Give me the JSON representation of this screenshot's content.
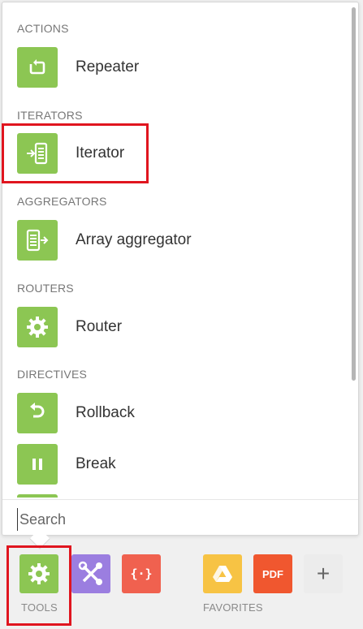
{
  "sections": [
    {
      "title": "ACTIONS",
      "items": [
        {
          "label": "Repeater",
          "icon": "repeat-icon"
        }
      ]
    },
    {
      "title": "ITERATORS",
      "items": [
        {
          "label": "Iterator",
          "icon": "iterator-icon"
        }
      ]
    },
    {
      "title": "AGGREGATORS",
      "items": [
        {
          "label": "Array aggregator",
          "icon": "aggregator-icon"
        }
      ]
    },
    {
      "title": "ROUTERS",
      "items": [
        {
          "label": "Router",
          "icon": "gear-icon"
        }
      ]
    },
    {
      "title": "DIRECTIVES",
      "items": [
        {
          "label": "Rollback",
          "icon": "rollback-icon"
        },
        {
          "label": "Break",
          "icon": "pause-icon"
        }
      ]
    }
  ],
  "search": {
    "placeholder": "Search",
    "value": ""
  },
  "dock": {
    "tools_label": "TOOLS",
    "favorites_label": "FAVORITES",
    "pdf_label": "PDF",
    "json_label": "{·}",
    "add_label": "+"
  },
  "colors": {
    "tile_green": "#8cc653",
    "flow_purple": "#9b7ee0",
    "json_red": "#f0614f",
    "drive_yellow": "#f7c344",
    "pdf_orange": "#f0572f",
    "highlight_red": "#e0151f"
  }
}
